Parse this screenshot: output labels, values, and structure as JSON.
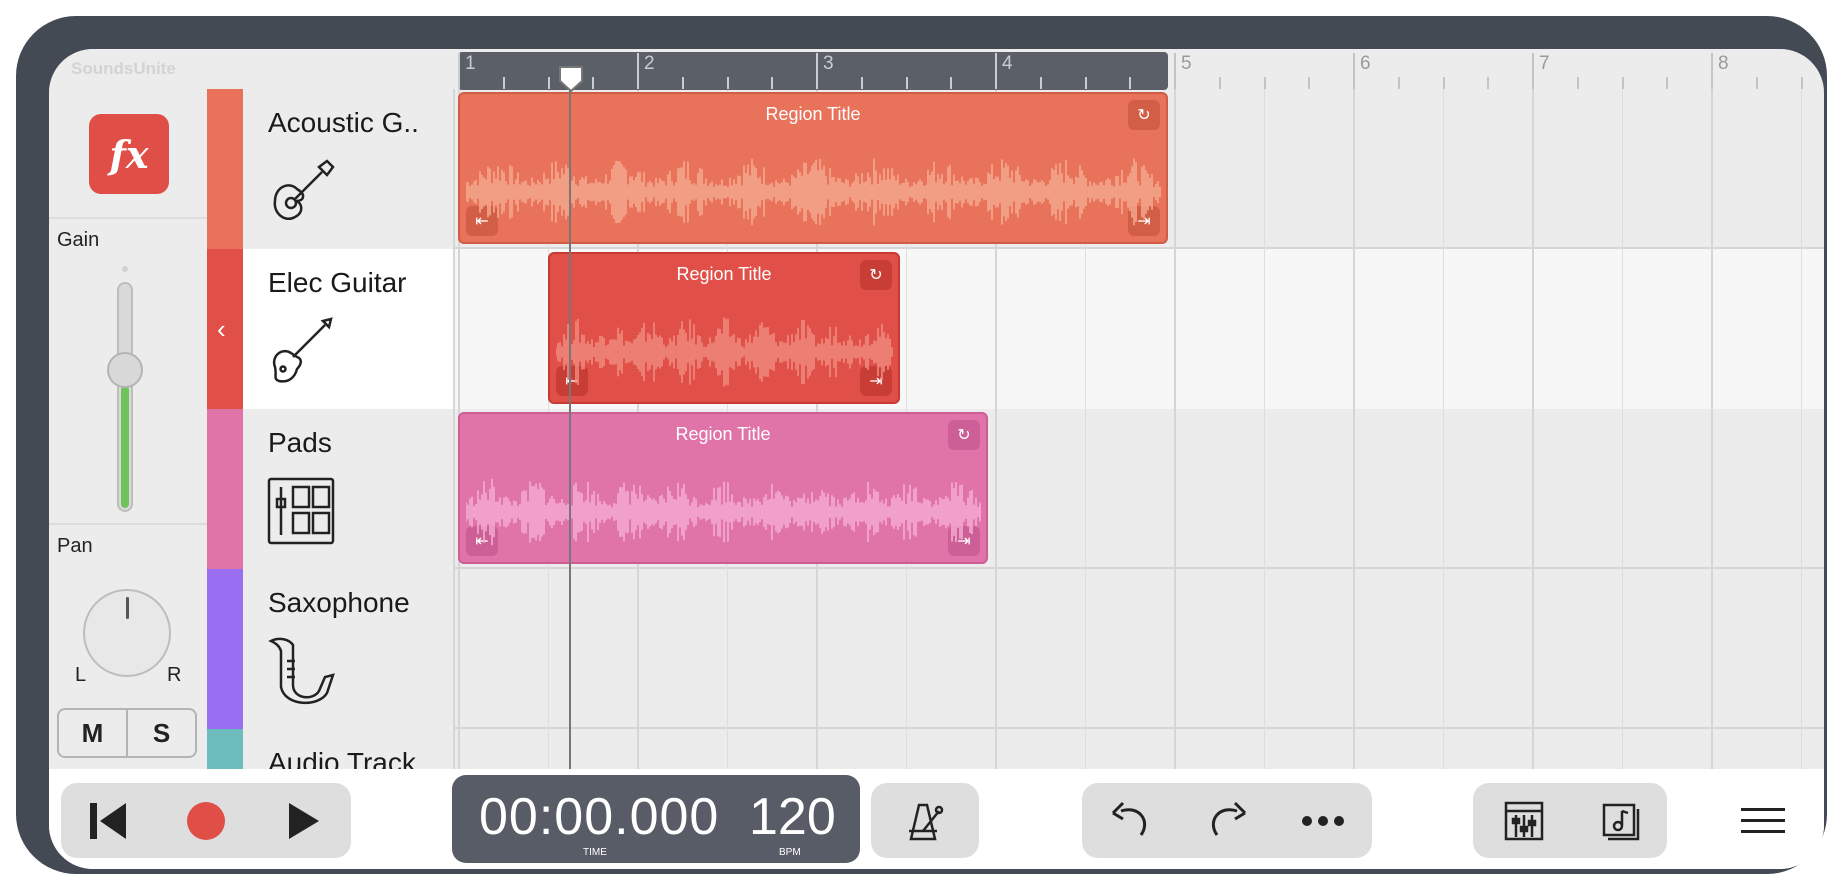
{
  "app": {
    "name": "SoundsUnite"
  },
  "inspector": {
    "fx_label": "fx",
    "gain_label": "Gain",
    "gain_level": 0.55,
    "pan_label": "Pan",
    "pan_left": "L",
    "pan_right": "R",
    "mute_label": "M",
    "solo_label": "S"
  },
  "ruler": {
    "bars": [
      "1",
      "2",
      "3",
      "4",
      "5",
      "6",
      "7",
      "8"
    ]
  },
  "tracks": [
    {
      "name": "Acoustic G..",
      "color": "#e8735a",
      "icon": "acoustic-guitar-icon"
    },
    {
      "name": "Elec Guitar",
      "color": "#e05048",
      "icon": "electric-guitar-icon",
      "selected": true
    },
    {
      "name": "Pads",
      "color": "#e074a8",
      "icon": "drum-pads-icon"
    },
    {
      "name": "Saxophone",
      "color": "#9a6ef0",
      "icon": "saxophone-icon"
    },
    {
      "name": "Audio Track",
      "color": "#6dbcbe",
      "icon": ""
    }
  ],
  "regions": [
    {
      "title": "Region Title",
      "track": 0,
      "color": "#e8735a"
    },
    {
      "title": "Region Title",
      "track": 1,
      "color": "#e05048"
    },
    {
      "title": "Region Title",
      "track": 2,
      "color": "#e074a8"
    }
  ],
  "transport": {
    "time": "00:00.000",
    "time_label": "TIME",
    "bpm": "120",
    "bpm_label": "BPM"
  }
}
